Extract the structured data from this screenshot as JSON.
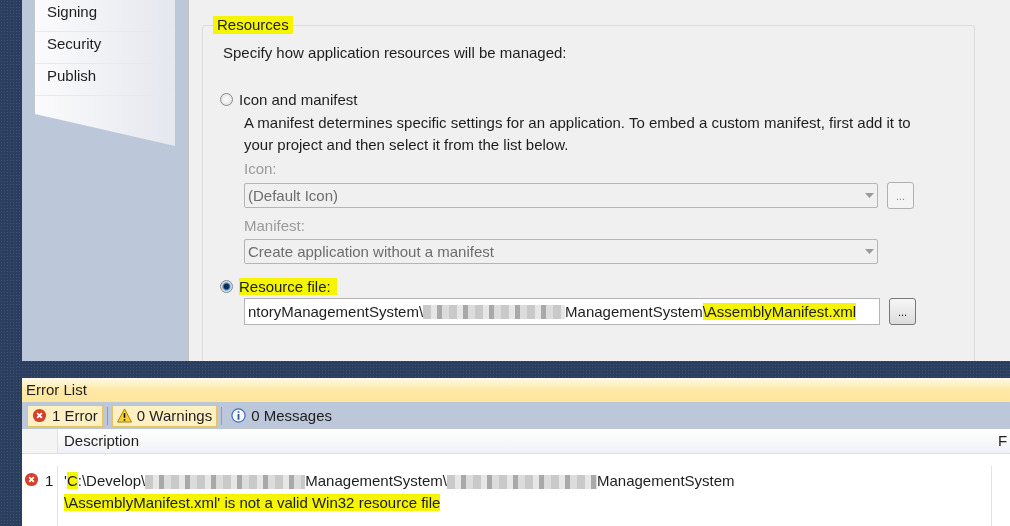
{
  "sidebar": {
    "items": [
      {
        "label": "Signing",
        "selected": false
      },
      {
        "label": "Security",
        "selected": false
      },
      {
        "label": "Publish",
        "selected": false
      }
    ]
  },
  "resources": {
    "title": "Resources",
    "title_highlighted": true,
    "intro": "Specify how application resources will be managed:",
    "options": [
      {
        "label": "Icon and manifest",
        "selected": false,
        "highlighted": false
      },
      {
        "label": "Resource file:",
        "selected": true,
        "highlighted": true
      }
    ],
    "description": "A manifest determines specific settings for an application. To embed a custom manifest, first add it to your project and then select it from the list below.",
    "icon_field": {
      "label": "Icon:",
      "value": "(Default Icon)",
      "disabled": true,
      "browse": "..."
    },
    "manifest_field": {
      "label": "Manifest:",
      "value": "Create application without a manifest",
      "disabled": true
    },
    "resource_path": {
      "browse": "...",
      "segments": [
        {
          "kind": "text",
          "text": "ntoryManagementSystem\\",
          "highlighted": false
        },
        {
          "kind": "redacted"
        },
        {
          "kind": "text",
          "text": "ManagementSystem",
          "highlighted": false
        },
        {
          "kind": "text",
          "text": "\\AssemblyManifest.xml",
          "highlighted": true
        }
      ]
    }
  },
  "error_list": {
    "title": "Error List",
    "filters": [
      {
        "kind": "error",
        "label": "1 Error",
        "selected": true
      },
      {
        "kind": "warning",
        "label": "0 Warnings",
        "selected": true
      },
      {
        "kind": "info",
        "label": "0 Messages",
        "selected": false
      }
    ],
    "columns": [
      {
        "label": "Description"
      },
      {
        "label": "F"
      }
    ],
    "rows": [
      {
        "kind": "error",
        "number": "1",
        "lines": [
          [
            {
              "kind": "text",
              "parts": [
                {
                  "text": "'",
                  "highlighted": false
                },
                {
                  "text": "C",
                  "highlighted": true
                },
                {
                  "text": ":\\Develop\\",
                  "highlighted": false
                }
              ]
            },
            {
              "kind": "redacted"
            },
            {
              "kind": "text",
              "parts": [
                {
                  "text": "ManagementSystem\\",
                  "highlighted": false
                }
              ]
            },
            {
              "kind": "redacted"
            },
            {
              "kind": "text",
              "parts": [
                {
                  "text": "ManagementSystem",
                  "highlighted": false
                }
              ]
            }
          ],
          [
            {
              "kind": "text",
              "parts": [
                {
                  "text": "\\AssemblyManifest.xml' is not a valid Win32 resource file",
                  "highlighted": true
                }
              ]
            }
          ]
        ]
      }
    ]
  }
}
